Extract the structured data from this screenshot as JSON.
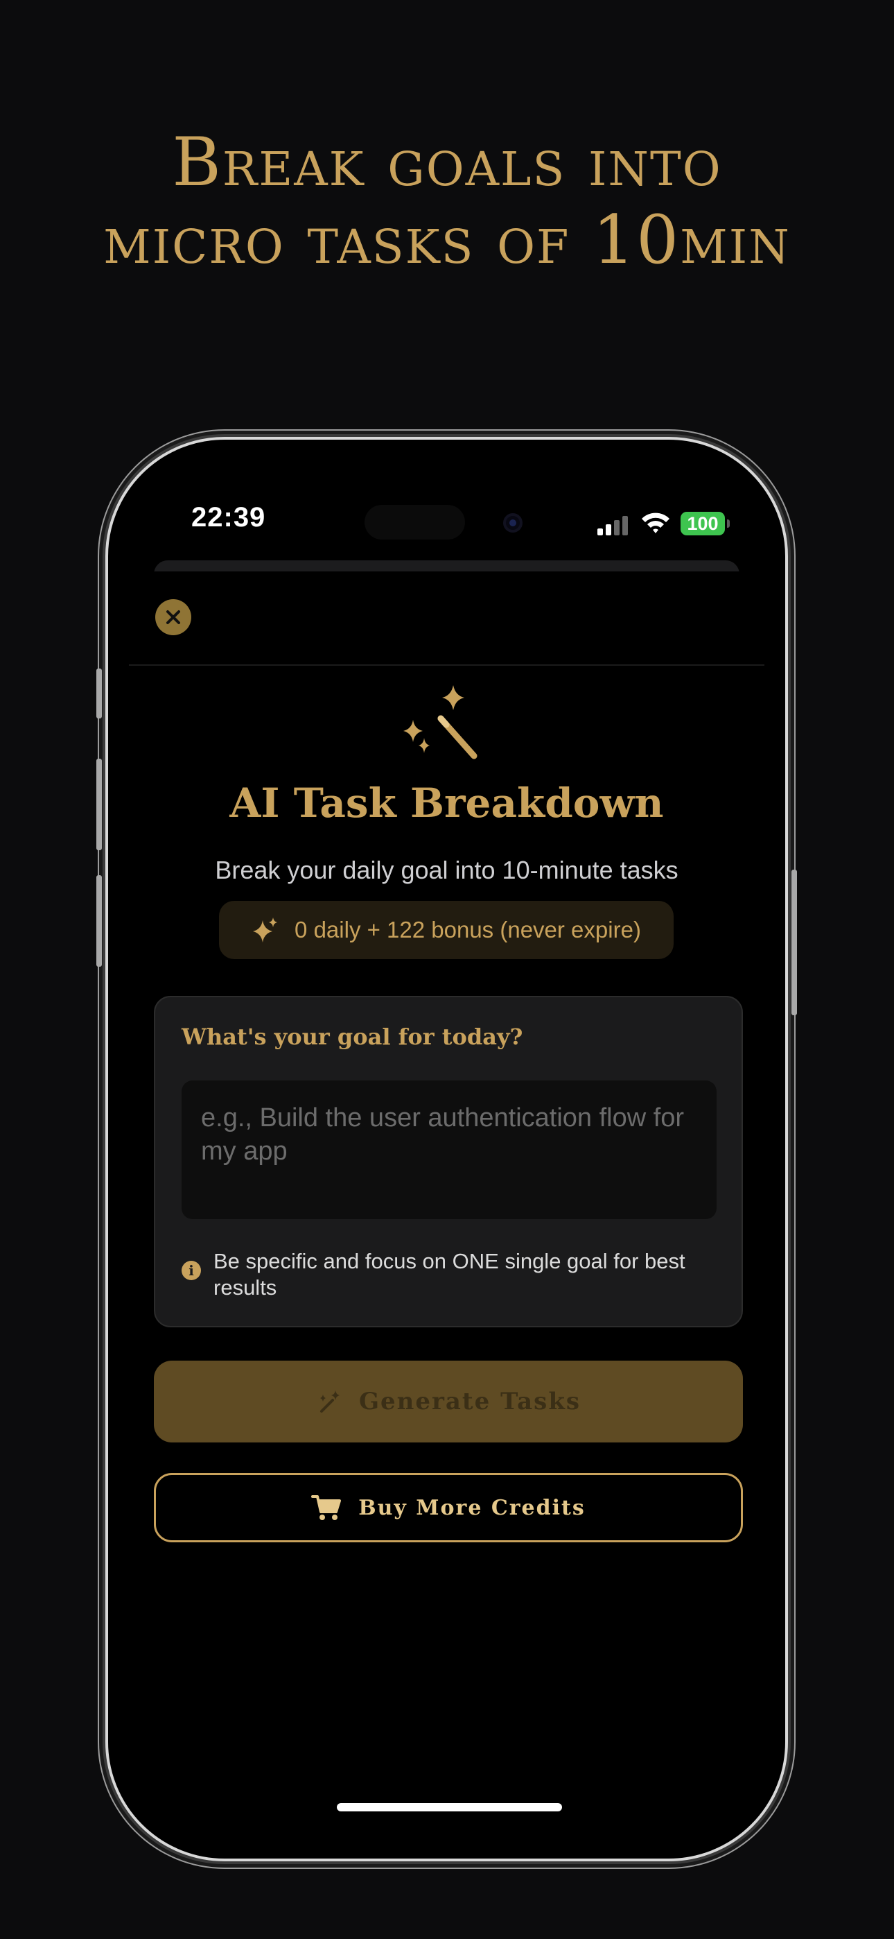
{
  "promo": {
    "headline_line1": "Break goals into",
    "headline_line2": "micro tasks of 10min"
  },
  "status_bar": {
    "time": "22:39",
    "battery": "100"
  },
  "sheet": {
    "close_icon": "xmark-icon",
    "hero_icon": "magic-wand-icon",
    "title": "AI Task Breakdown",
    "subtitle": "Break your daily goal into 10-minute tasks",
    "credits": {
      "icon": "sparkles-icon",
      "text": "0 daily + 122 bonus (never expire)"
    },
    "goal_card": {
      "label": "What's your goal for today?",
      "input_value": "",
      "input_placeholder": "e.g., Build the user authentication flow for my app",
      "hint_icon": "info-icon",
      "hint": "Be specific and focus on ONE single goal for best results"
    },
    "generate_button": {
      "label": "Generate Tasks",
      "icon": "magic-wand-icon"
    },
    "buy_button": {
      "label": "Buy More Credits",
      "icon": "cart-icon"
    }
  },
  "colors": {
    "background": "#0c0c0d",
    "accent_gold": "#c9a25c",
    "disabled_gold": "#5f4b23",
    "battery_green": "#3ec44f"
  }
}
